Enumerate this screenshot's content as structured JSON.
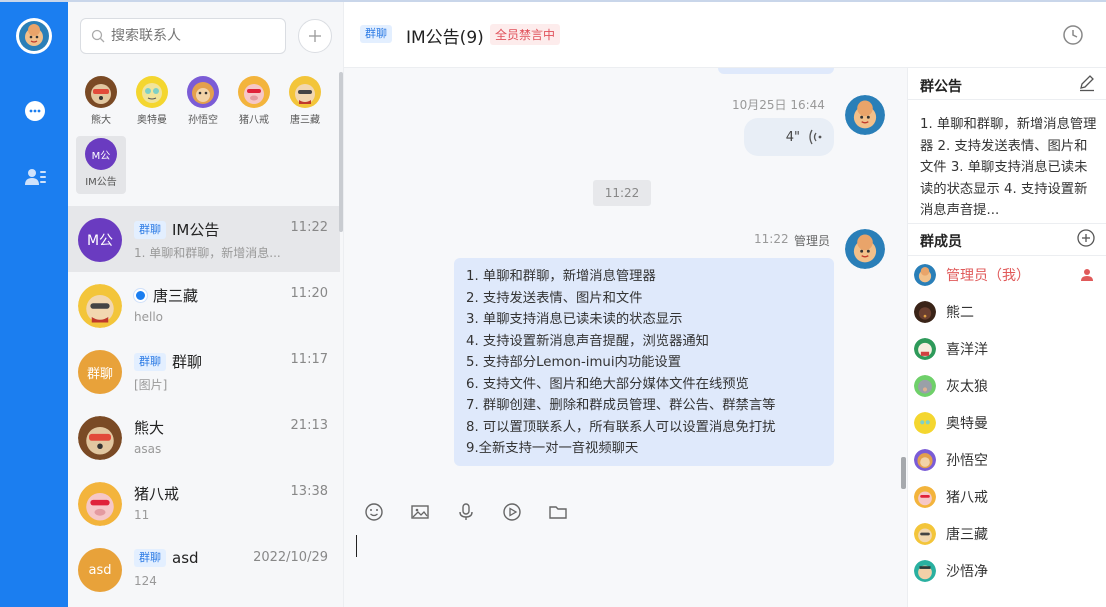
{
  "search": {
    "placeholder": "搜索联系人"
  },
  "quick_contacts": [
    {
      "label": "熊大",
      "avatar": "bear"
    },
    {
      "label": "奥特曼",
      "avatar": "ultraman"
    },
    {
      "label": "孙悟空",
      "avatar": "monkey"
    },
    {
      "label": "猪八戒",
      "avatar": "pig"
    },
    {
      "label": "唐三藏",
      "avatar": "monk"
    },
    {
      "label": "IM公告",
      "avatar": "M公",
      "selected": true
    }
  ],
  "conversations": [
    {
      "tag": "群聊",
      "name": "IM公告",
      "time": "11:22",
      "preview": "1. 单聊和群聊，新增消息...",
      "avatar_text": "M公",
      "avatar_color": "#6a3bc0",
      "selected": true
    },
    {
      "tag": "",
      "name": "唐三藏",
      "time": "11:20",
      "preview": "hello",
      "avatar": "monk",
      "online_dot": true
    },
    {
      "tag": "群聊",
      "name": "群聊",
      "time": "11:17",
      "preview": "[图片]",
      "avatar_text": "群聊",
      "avatar_color": "#e8a23a"
    },
    {
      "tag": "",
      "name": "熊大",
      "time": "21:13",
      "preview": "asas",
      "avatar": "bear"
    },
    {
      "tag": "",
      "name": "猪八戒",
      "time": "13:38",
      "preview": "11",
      "avatar": "pig"
    },
    {
      "tag": "群聊",
      "name": "asd",
      "time": "2022/10/29",
      "preview": "124",
      "avatar_text": "asd",
      "avatar_color": "#e8a23a"
    }
  ],
  "header": {
    "tag": "群聊",
    "title": "IM公告(9)",
    "badge": "全员禁言中"
  },
  "messages": {
    "voice_time": "10月25日 16:44",
    "voice_duration": "4\"",
    "separator": "11:22",
    "announce_time": "11:22",
    "announce_sender": "管理员",
    "announce_lines": [
      "1. 单聊和群聊，新增消息管理器",
      "2. 支持发送表情、图片和文件",
      "3. 单聊支持消息已读未读的状态显示",
      "4. 支持设置新消息声音提醒，浏览器通知",
      "5. 支持部分Lemon-imui内功能设置",
      "6. 支持文件、图片和绝大部分媒体文件在线预览",
      "7. 群聊创建、删除和群成员管理、群公告、群禁言等",
      "8. 可以置顶联系人，所有联系人可以设置消息免打扰",
      "9.全新支持一对一音视频聊天"
    ]
  },
  "right_panel": {
    "notice_title": "群公告",
    "notice_text": "1. 单聊和群聊，新增消息管理器 2. 支持发送表情、图片和文件 3. 单聊支持消息已读未读的状态显示 4. 支持设置新消息声音提...",
    "members_title": "群成员",
    "members": [
      {
        "name": "管理员（我）",
        "avatar": "monk-blue",
        "self": true
      },
      {
        "name": "熊二",
        "avatar": "bear2"
      },
      {
        "name": "喜洋洋",
        "avatar": "sheep"
      },
      {
        "name": "灰太狼",
        "avatar": "wolf"
      },
      {
        "name": "奥特曼",
        "avatar": "ultraman"
      },
      {
        "name": "孙悟空",
        "avatar": "monkey"
      },
      {
        "name": "猪八戒",
        "avatar": "pig"
      },
      {
        "name": "唐三藏",
        "avatar": "monk"
      },
      {
        "name": "沙悟净",
        "avatar": "sha"
      }
    ]
  },
  "colors": {
    "accent": "#1b7ef0",
    "bubble": "#dfe9fb",
    "danger": "#e0505a"
  }
}
